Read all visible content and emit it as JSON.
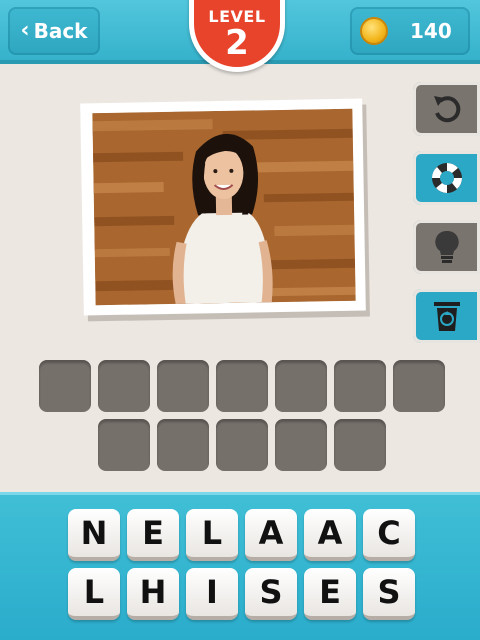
{
  "header": {
    "back_label": "Back",
    "level_label": "LEVEL",
    "level_number": "2",
    "coins": "140"
  },
  "side_buttons": [
    {
      "icon": "undo-icon",
      "style": "gray"
    },
    {
      "icon": "lifebuoy-icon",
      "style": "blue"
    },
    {
      "icon": "lightbulb-icon",
      "style": "gray"
    },
    {
      "icon": "trash-icon",
      "style": "blue"
    }
  ],
  "answer": {
    "row1_slots": 7,
    "row2_slots": 5
  },
  "letters": {
    "row1": [
      "N",
      "E",
      "L",
      "A",
      "A",
      "C"
    ],
    "row2": [
      "L",
      "H",
      "I",
      "S",
      "E",
      "S"
    ]
  },
  "colors": {
    "header": "#36b2cc",
    "level_badge": "#e8442c",
    "panel": "#2aaccb",
    "slot": "#76706b"
  }
}
